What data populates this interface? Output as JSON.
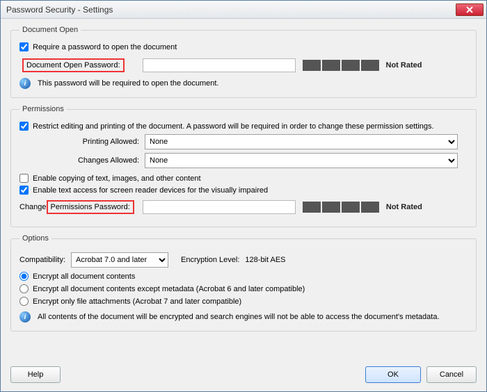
{
  "window": {
    "title": "Password Security - Settings"
  },
  "docOpen": {
    "legend": "Document Open",
    "require": "Require a password to open the document",
    "pwLabel": "Document Open Password:",
    "notRated": "Not Rated",
    "info": "This password will be required to open the document."
  },
  "perm": {
    "legend": "Permissions",
    "restrict": "Restrict editing and printing of the document. A password will be required in order to change these permission settings.",
    "printingLabel": "Printing Allowed:",
    "printingValue": "None",
    "changesLabel": "Changes Allowed:",
    "changesValue": "None",
    "enableCopy": "Enable copying of text, images, and other content",
    "enableAccess": "Enable text access for screen reader devices for the visually impaired",
    "changePwPrefix": "Change ",
    "changePwLabel": "Permissions Password:",
    "notRated": "Not Rated"
  },
  "options": {
    "legend": "Options",
    "compatLabel": "Compatibility:",
    "compatValue": "Acrobat 7.0 and later",
    "encLevelLabel": "Encryption Level:",
    "encLevelValue": "128-bit AES",
    "r1": "Encrypt all document contents",
    "r2": "Encrypt all document contents except metadata (Acrobat 6 and later compatible)",
    "r3": "Encrypt only file attachments (Acrobat 7 and later compatible)",
    "info": "All contents of the document will be encrypted and search engines will not be able to access the document's metadata."
  },
  "buttons": {
    "help": "Help",
    "ok": "OK",
    "cancel": "Cancel"
  }
}
